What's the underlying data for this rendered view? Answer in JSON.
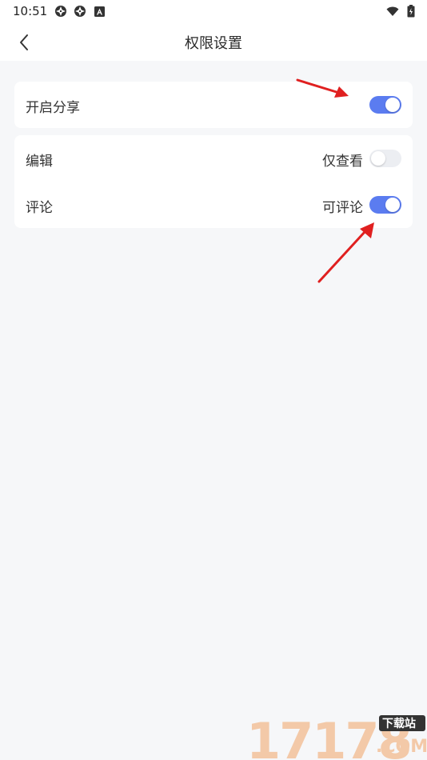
{
  "status_bar": {
    "time": "10:51",
    "icons": [
      "app-notification-icon",
      "app-notification-icon",
      "a-badge-icon",
      "wifi-icon",
      "battery-icon"
    ]
  },
  "header": {
    "title": "权限设置",
    "back_icon": "chevron-left-icon"
  },
  "sections": {
    "share": {
      "label": "开启分享",
      "enabled": true
    },
    "permissions": [
      {
        "label": "编辑",
        "state_text": "仅查看",
        "enabled": false
      },
      {
        "label": "评论",
        "state_text": "可评论",
        "enabled": true
      }
    ]
  },
  "colors": {
    "toggle_on": "#5b7cf0",
    "toggle_off": "#eceef2",
    "background": "#f6f7f9",
    "annotation_arrow": "#e02020"
  },
  "watermark": {
    "logo_text": "17178",
    "tag": "下载站",
    "sub": ".COM"
  }
}
